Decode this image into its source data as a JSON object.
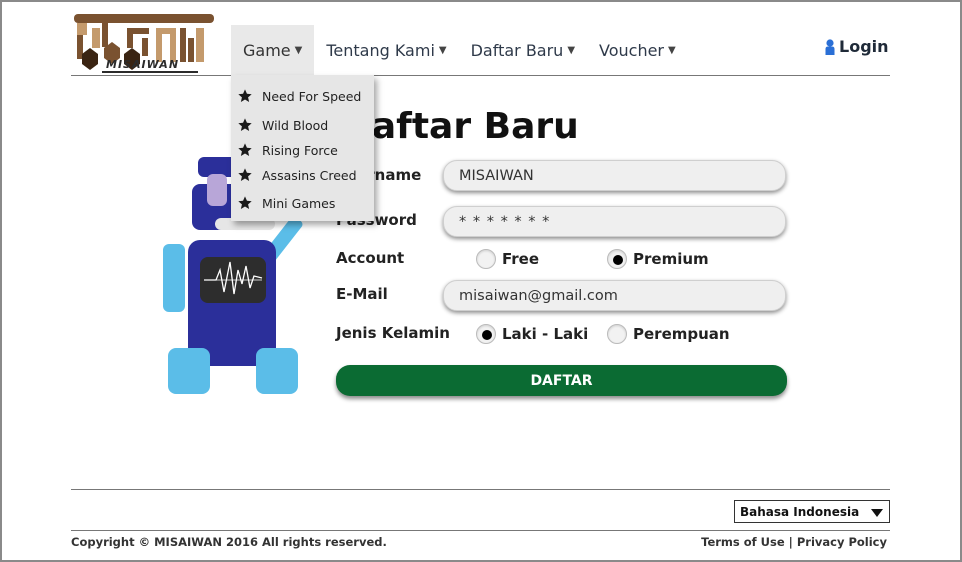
{
  "brand": {
    "logo_text": "MISAIWAN",
    "logo_colors": {
      "brown": "#7a5230",
      "tan": "#c49a6c",
      "dark": "#3a2412"
    }
  },
  "nav": {
    "items": [
      {
        "label": "Game",
        "active": true
      },
      {
        "label": "Tentang Kami"
      },
      {
        "label": "Daftar Baru"
      },
      {
        "label": "Voucher"
      }
    ],
    "login_label": "Login"
  },
  "dropdown": {
    "items": [
      {
        "label": "Need For Speed",
        "icon": "star-icon"
      },
      {
        "label": "Wild Blood",
        "icon": "star-icon"
      },
      {
        "label": "Rising Force",
        "icon": "star-icon"
      },
      {
        "label": "Assasins Creed",
        "icon": "star-icon"
      },
      {
        "label": "Mini Games",
        "icon": "star-icon"
      }
    ]
  },
  "page": {
    "title": "Daftar Baru"
  },
  "form": {
    "username_label": "Username",
    "username_value": "MISAIWAN",
    "password_label": "Password",
    "password_value": "* * * * * * *",
    "account_label": "Account",
    "account_options": [
      {
        "label": "Free",
        "selected": false
      },
      {
        "label": "Premium",
        "selected": true
      }
    ],
    "email_label": "E-Mail",
    "email_value": "misaiwan@gmail.com",
    "gender_label": "Jenis Kelamin",
    "gender_options": [
      {
        "label": "Laki - Laki",
        "selected": true
      },
      {
        "label": "Perempuan",
        "selected": false
      }
    ],
    "submit_label": "DAFTAR"
  },
  "footer": {
    "language": "Bahasa Indonesia",
    "copyright": "Copyright © MISAIWAN 2016 All rights reserved.",
    "terms": "Terms of Use",
    "separator": "|",
    "privacy": "Privacy Policy"
  },
  "colors": {
    "accent_green": "#0b6b33",
    "robot_blue": "#2b2f9a",
    "robot_light_blue": "#5bbde8"
  }
}
